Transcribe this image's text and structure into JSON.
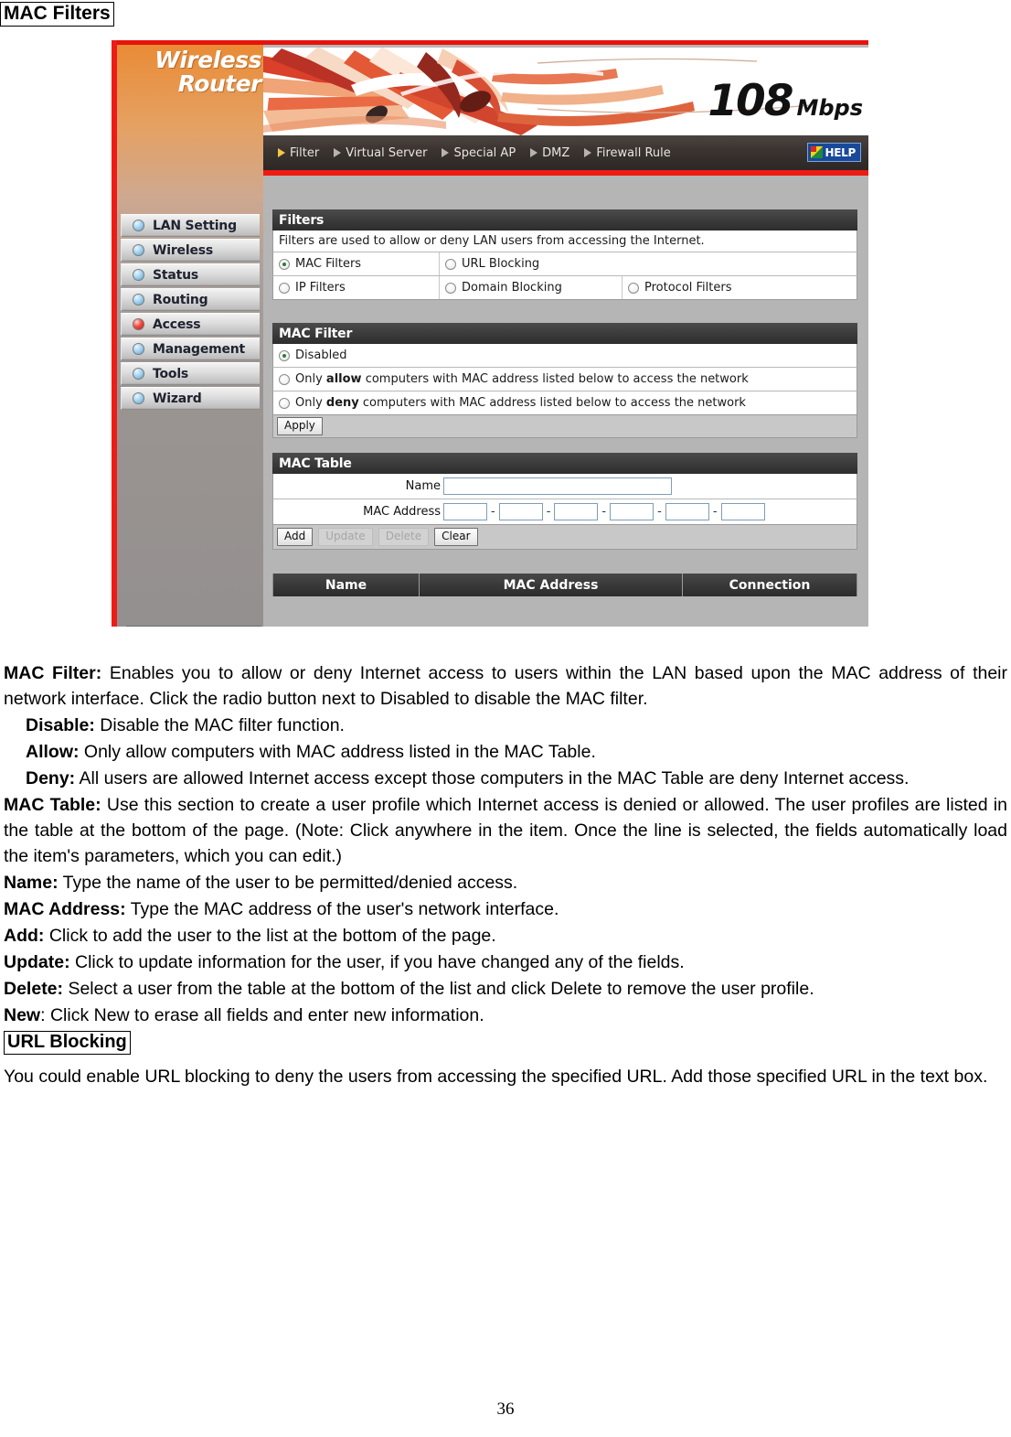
{
  "document": {
    "title": "MAC Filters",
    "page_number": "36"
  },
  "screenshot": {
    "brand": {
      "line1": "Wireless",
      "line2": "Router"
    },
    "banner": {
      "speed": "108",
      "unit": "Mbps"
    },
    "topnav": {
      "items": [
        {
          "label": "Filter",
          "active": true
        },
        {
          "label": "Virtual Server",
          "active": false
        },
        {
          "label": "Special AP",
          "active": false
        },
        {
          "label": "DMZ",
          "active": false
        },
        {
          "label": "Firewall Rule",
          "active": false
        }
      ],
      "help_label": "HELP"
    },
    "sidebar": {
      "items": [
        {
          "label": "LAN Setting",
          "active": false
        },
        {
          "label": "Wireless",
          "active": false
        },
        {
          "label": "Status",
          "active": false
        },
        {
          "label": "Routing",
          "active": false
        },
        {
          "label": "Access",
          "active": true
        },
        {
          "label": "Management",
          "active": false
        },
        {
          "label": "Tools",
          "active": false
        },
        {
          "label": "Wizard",
          "active": false
        }
      ]
    },
    "filters_panel": {
      "title": "Filters",
      "description": "Filters are used to allow or deny LAN users from accessing the Internet.",
      "options_row1": [
        {
          "label": "MAC Filters",
          "selected": true
        },
        {
          "label": "URL Blocking",
          "selected": false
        }
      ],
      "options_row2": [
        {
          "label": "IP Filters",
          "selected": false
        },
        {
          "label": "Domain Blocking",
          "selected": false
        },
        {
          "label": "Protocol Filters",
          "selected": false
        }
      ]
    },
    "mac_filter_panel": {
      "title": "MAC Filter",
      "mode_disabled": "Disabled",
      "mode_allow_pre": "Only ",
      "mode_allow_bold": "allow",
      "mode_allow_post": " computers with MAC address listed below to access the network",
      "mode_deny_pre": "Only ",
      "mode_deny_bold": "deny",
      "mode_deny_post": " computers with MAC address listed below to access the network",
      "apply_label": "Apply"
    },
    "mac_table_panel": {
      "title": "MAC Table",
      "name_label": "Name",
      "name_value": "",
      "mac_label": "MAC Address",
      "mac_segments": [
        "",
        "",
        "",
        "",
        "",
        ""
      ],
      "separator": "-",
      "buttons": [
        {
          "label": "Add",
          "disabled": false
        },
        {
          "label": "Update",
          "disabled": true
        },
        {
          "label": "Delete",
          "disabled": true
        },
        {
          "label": "Clear",
          "disabled": false
        }
      ],
      "table_headers": [
        "Name",
        "MAC Address",
        "Connection"
      ]
    }
  },
  "prose": {
    "mac_filter_term": "MAC Filter:",
    "mac_filter_text": " Enables you to allow or deny Internet access to users within the LAN based upon the MAC address of their network interface. Click the radio button next to Disabled to disable the MAC filter.",
    "disable_term": "Disable:",
    "disable_text": " Disable the MAC filter function.",
    "allow_term": "Allow:",
    "allow_text": " Only allow computers with MAC address listed in the MAC Table.",
    "deny_term": "Deny:",
    "deny_text": " All users are allowed Internet access except those computers in the MAC Table are deny Internet access.",
    "mac_table_term": "MAC Table:",
    "mac_table_text": " Use this section to create a user profile which Internet access is denied or allowed. The user profiles are listed in the table at the bottom of the page.  (Note: Click anywhere in the item. Once the line is selected, the fields automatically load the item's parameters, which you can edit.)",
    "name_term": "Name:",
    "name_text": " Type the name of the user to be permitted/denied access.",
    "mac_address_term": "MAC Address:",
    "mac_address_text": " Type the MAC address of the user's network interface.",
    "add_term": "Add:",
    "add_text": " Click to add the user to the list at the bottom of the page.",
    "update_term": "Update:",
    "update_text": " Click to update information for the user, if you have changed any of the fields.",
    "delete_term": "Delete:",
    "delete_text": " Select a user from the table at the bottom of the list and click Delete to remove the user profile.",
    "new_term": "New",
    "new_text": ": Click New to erase all fields and enter new information.",
    "url_blocking_heading": "URL Blocking",
    "url_blocking_text": "You could enable URL blocking to deny the users from accessing the specified URL.  Add those specified URL in the text box."
  }
}
